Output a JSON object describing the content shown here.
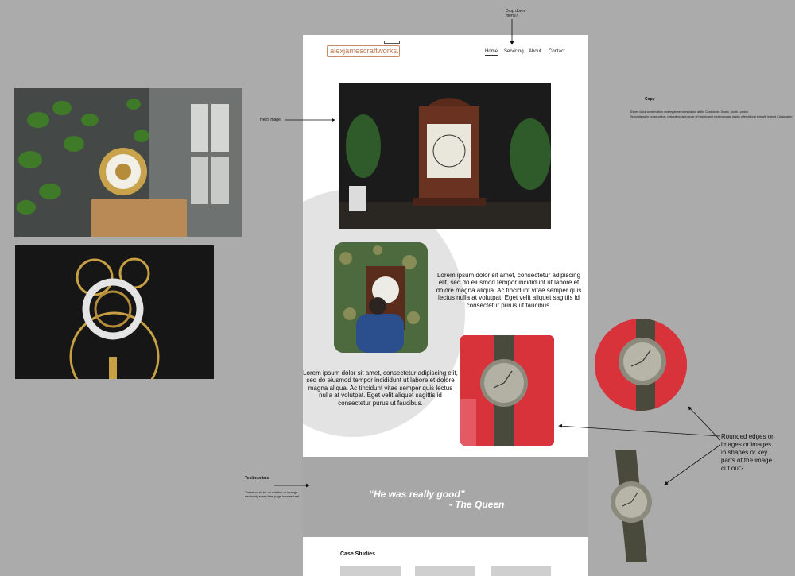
{
  "site": {
    "logo_text": "alexjamescraftworks.",
    "nav": [
      "Home",
      "Servicing",
      "About",
      "Contact"
    ],
    "body_text_1": "Lorem ipsum dolor sit amet, consectetur adipiscing elit, sed do eiusmod tempor incididunt ut labore et dolore magna aliqua. Ac tincidunt vitae semper quis lectus nulla at volutpat. Eget velit aliquet sagittis id consectetur purus ut faucibus.",
    "body_text_2": "Lorem ipsum dolor sit amet, consectetur adipiscing elit, sed do eiusmod tempor incididunt ut labore et dolore magna aliqua. Ac tincidunt vitae semper quis lectus nulla at volutpat. Eget velit aliquet sagittis id consectetur purus ut faucibus.",
    "quote": "“He was really good”",
    "quote_author": "- The Queen",
    "case_studies_title": "Case Studies"
  },
  "annotations": {
    "dropdown": "Drop down menu?",
    "hero": "Hero image",
    "copy_title": "Copy",
    "copy_line1": "Expert clock conservation and repair services based at the Clockworks Studio, South London.",
    "copy_line2": "Specialising in conservation, restoration and repair of historic and contemporary clocks offered by a formally trained Clockmaker.",
    "testimonials_title": "Testimonials",
    "testimonials_note": "These could be on rotation or change randomly every time page is refreshed",
    "rounded_note": "Rounded edges on images or images in shapes or key parts of the image cut out?"
  },
  "colors": {
    "canvas": "#ababab",
    "page": "#ffffff",
    "logo_accent": "#c07a52",
    "testimonial_band": "#a7a7a7",
    "red_accent": "#d8323b"
  }
}
